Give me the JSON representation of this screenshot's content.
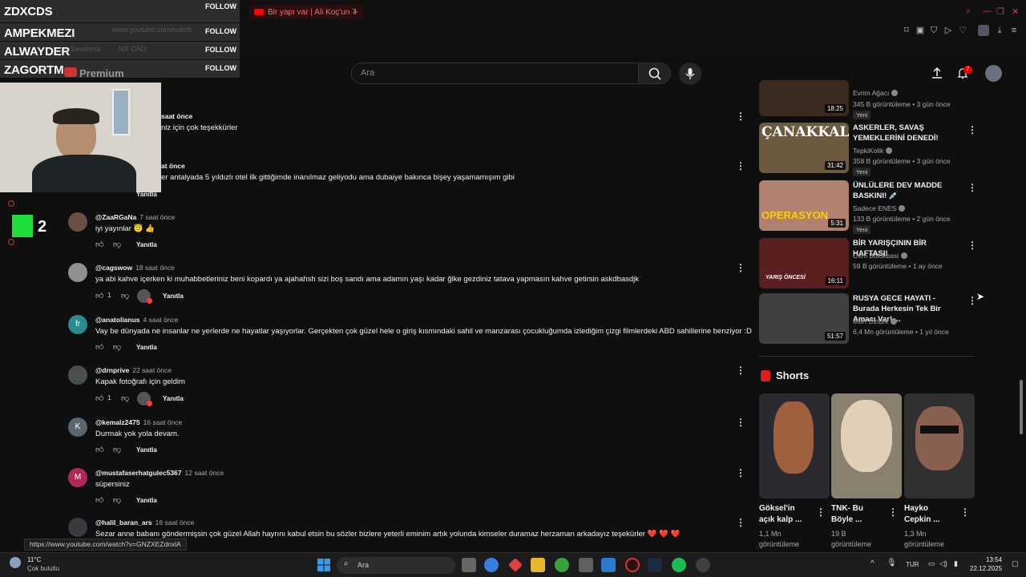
{
  "browser": {
    "tab_title": "Bir yapı var | Ali Koç'un 7",
    "url_ghost": "www.youtube.com/watch",
    "ghost_tabs": [
      "n Savunma",
      "NX CAD"
    ]
  },
  "overlay": {
    "follows": [
      {
        "name": "ZDXCDS",
        "button": "FOLLOW"
      },
      {
        "name": "AMPEKMEZI",
        "button": "FOLLOW"
      },
      {
        "name": "ALWAYDER",
        "button": "FOLLOW"
      },
      {
        "name": "ZAGORTM",
        "button": "FOLLOW"
      }
    ],
    "badge": "2"
  },
  "youtube": {
    "premium_label": "Premium",
    "search_placeholder": "Ara",
    "notif_count": "7"
  },
  "comments": [
    {
      "author": "",
      "time": "saat önce",
      "text": "niz için çok teşekkürler",
      "likes": "",
      "reply": "",
      "avatar_letter": ""
    },
    {
      "author": "",
      "time": "at önce",
      "text": "er antalyada 5 yıldızlı otel ilk gittiğimde inanılmaz geliyodu ama dubaiye bakınca bişey yaşamamışım gibi",
      "likes": "",
      "reply": "Yanıtla",
      "avatar_letter": ""
    },
    {
      "author": "@ZaaRGaNa",
      "time": "7 saat önce",
      "text": "iyi yayınlar 😇 👍",
      "likes": "",
      "reply": "Yanıtla",
      "avatar_letter": ""
    },
    {
      "author": "@cagswow",
      "time": "18 saat önce",
      "text": "ya abi kahve içerken ki muhabbetleriniz beni kopardı ya ajahahsh  sizi boş sandı ama adamın yaşı kadar ğlke gezdiniz tatava yapmasın kahve getirsin askdbasdjk",
      "likes": "1",
      "reply": "Yanıtla",
      "avatar_letter": ""
    },
    {
      "author": "@anatolianus",
      "time": "4 saat önce",
      "text": "Vay be dünyada ne insanlar ne yerlerde ne hayatlar yaşıyorlar. Gerçekten çok güzel hele o giriş kısmındaki sahil ve manzarası çocukluğumda izlediğim çizgi filmlerdeki ABD sahillerine benziyor :D",
      "likes": "",
      "reply": "Yanıtla",
      "avatar_letter": "fr"
    },
    {
      "author": "@drnprive",
      "time": "22 saat önce",
      "text": "Kapak fotoğrafı için geldim",
      "likes": "1",
      "reply": "Yanıtla",
      "avatar_letter": ""
    },
    {
      "author": "@kemalz2475",
      "time": "16 saat önce",
      "text": "Durmak yok yola devam.",
      "likes": "",
      "reply": "Yanıtla",
      "avatar_letter": "K"
    },
    {
      "author": "@mustafaserhatgulec5367",
      "time": "12 saat önce",
      "text": "süpersiniz",
      "likes": "",
      "reply": "Yanıtla",
      "avatar_letter": "M"
    },
    {
      "author": "@halil_baran_ars",
      "time": "16 saat önce",
      "text": "Sezar anne babanı göndermişsin çok güzel Allah hayrını kabul etsin bu sözler bizlere yeterli eminim artık yolunda kimseler duramaz herzaman arkadayız teşekürler ❤️ ❤️ ❤️",
      "likes": "",
      "reply": "",
      "avatar_letter": ""
    }
  ],
  "recommendations": [
    {
      "title": "",
      "channel": "Evrim Ağacı",
      "meta": "345 B görüntüleme • 3 gün önce",
      "badge": "Yeni",
      "duration": "18:25",
      "color": "#3a2a20"
    },
    {
      "title": "ASKERLER, SAVAŞ YEMEKLERİNİ DENEDİ!",
      "channel": "TepkiKolik",
      "meta": "358 B görüntüleme • 3 gün önce",
      "badge": "Yeni",
      "duration": "31:42",
      "color": "#6b5a40",
      "thumb_text": "ÇANAKKALE"
    },
    {
      "title": "ÜNLÜLERE DEV MADDE BASKINI! 💉",
      "channel": "Sadece ENES",
      "meta": "133 B görüntüleme • 2 gün önce",
      "badge": "Yeni",
      "duration": "5:31",
      "color": "#b08070",
      "thumb_text": "OPERASYON"
    },
    {
      "title": "BİR YARIŞÇININ BİR HAFTASI!",
      "channel": "Cem Bolukbasi",
      "meta": "59 B görüntüleme • 1 ay önce",
      "badge": "",
      "duration": "16:11",
      "color": "#5a2020",
      "thumb_text": "YARIŞ ÖNCESİ"
    },
    {
      "title": "RUSYA GECE HAYATI - Burada Herkesin Tek Bir Amacı Var! ...",
      "channel": "Mert Öztürk",
      "meta": "6,4 Mn görüntüleme • 1 yıl önce",
      "badge": "",
      "duration": "51:57",
      "color": "#404040"
    }
  ],
  "shorts": {
    "heading": "Shorts",
    "items": [
      {
        "title_1": "Göksel'in",
        "title_2": "açık kalp ...",
        "views": "1,1 Mn",
        "views_label": "görüntüleme",
        "color": "#2a2a30"
      },
      {
        "title_1": "TNK- Bu",
        "title_2": "Böyle ...",
        "views": "19 B",
        "views_label": "görüntüleme",
        "color": "#8a8070"
      },
      {
        "title_1": "Hayko",
        "title_2": "Cepkin ...",
        "views": "1,3 Mn",
        "views_label": "görüntüleme",
        "color": "#303030"
      }
    ]
  },
  "status": {
    "url_tooltip": "https://www.youtube.com/watch?v=GNZXEZdnxlA"
  },
  "taskbar": {
    "weather_temp": "11°C",
    "weather_desc": "Çok bulutlu",
    "search_label": "Ara",
    "lang": "TUR",
    "time": "13:54",
    "date": "22.12.2025"
  }
}
